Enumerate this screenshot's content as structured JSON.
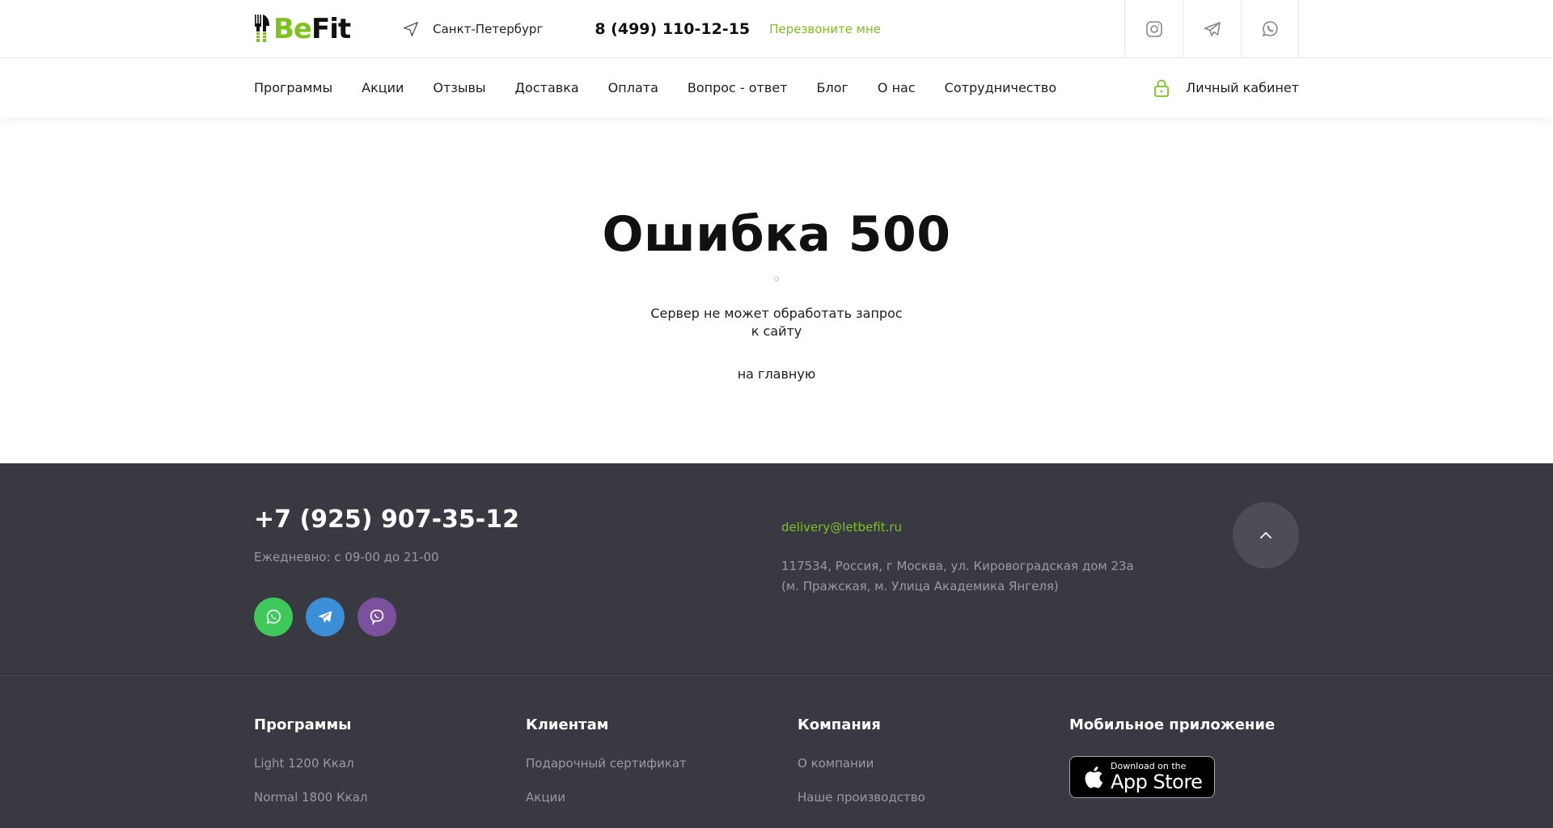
{
  "header": {
    "logo_be": "Be",
    "logo_fit": "Fit",
    "city": "Санкт-Петербург",
    "phone": "8 (499) 110-12-15",
    "callback": "Перезвоните мне",
    "social_icons": [
      "instagram-icon",
      "telegram-icon",
      "whatsapp-icon"
    ]
  },
  "nav": {
    "items": [
      "Программы",
      "Акции",
      "Отзывы",
      "Доставка",
      "Оплата",
      "Вопрос - ответ",
      "Блог",
      "О нас",
      "Сотрудничество"
    ],
    "account": "Личный кабинет"
  },
  "main": {
    "title": "Ошибка 500",
    "description": "Сервер не может обработать запрос к сайту",
    "home_link": "на главную"
  },
  "footer": {
    "phone": "+7 (925) 907-35-12",
    "hours": "Ежедневно: с 09-00 до 21-00",
    "email": "delivery@letbefit.ru",
    "address_line1": "117534, Россия, г Москва, ул. Кировоградская дом 23а",
    "address_line2": "(м. Пражская, м. Улица Академика Янгеля)",
    "messengers": [
      "whatsapp-icon",
      "telegram-icon",
      "viber-icon"
    ],
    "columns": [
      {
        "title": "Программы",
        "links": [
          "Light 1200 Ккал",
          "Normal 1800 Ккал"
        ]
      },
      {
        "title": "Клиентам",
        "links": [
          "Подарочный сертификат",
          "Акции"
        ]
      },
      {
        "title": "Компания",
        "links": [
          "О компании",
          "Наше производство"
        ]
      },
      {
        "title": "Мобильное приложение",
        "links": []
      }
    ],
    "appstore_small": "Download on the",
    "appstore_big": "App Store"
  },
  "colors": {
    "accent": "#7dc21e",
    "footer_bg": "#393942",
    "whatsapp": "#3ec95a",
    "telegram": "#3a8fd6",
    "viber": "#7b519d"
  }
}
